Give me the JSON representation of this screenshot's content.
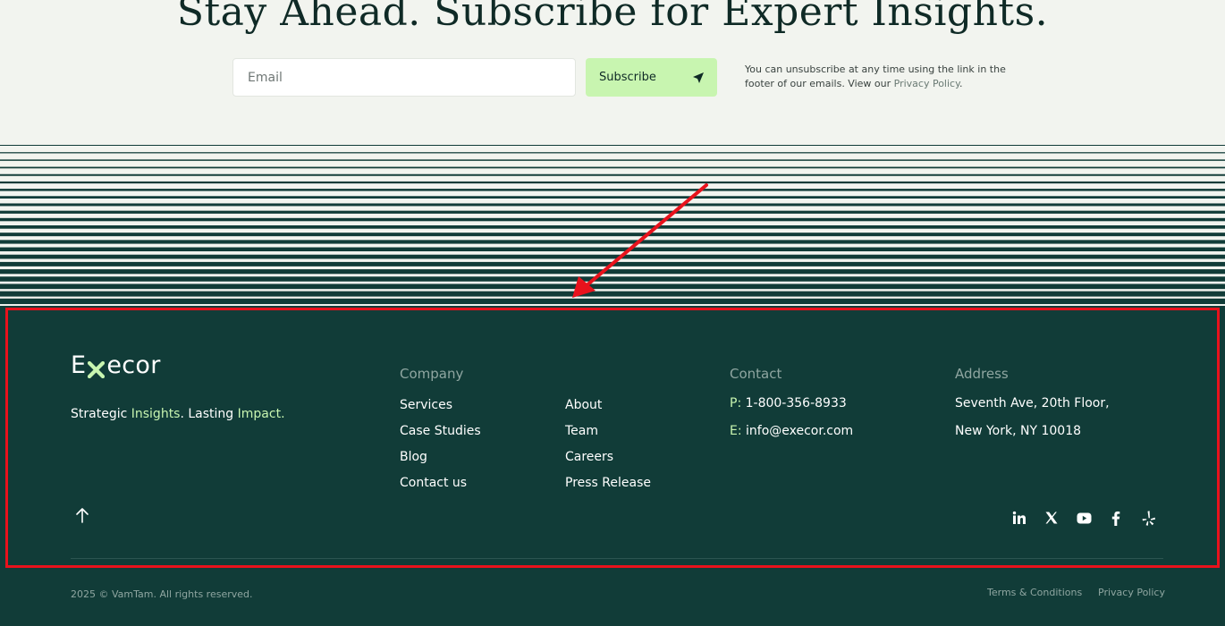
{
  "subscribe": {
    "title": "Stay Ahead. Subscribe for Expert Insights.",
    "email_placeholder": "Email",
    "button_label": "Subscribe",
    "note_text": "You can unsubscribe at any time using the link in the footer of our emails. View our ",
    "note_link": "Privacy Policy",
    "note_end": "."
  },
  "footer": {
    "logo_prefix": "E",
    "logo_suffix": "ecor",
    "tagline_1": "Strategic ",
    "tagline_accent_1": "Insights",
    "tagline_2": ". Lasting ",
    "tagline_accent_2": "Impact.",
    "company_heading": "Company",
    "company_links_left": [
      "Services",
      "Case Studies",
      "Blog",
      "Contact us"
    ],
    "company_links_right": [
      "About",
      "Team",
      "Careers",
      "Press Release"
    ],
    "contact_heading": "Contact",
    "phone_prefix": "P:",
    "phone": "1-800-356-8933",
    "email_prefix": "E:",
    "email": "info@execor.com",
    "address_heading": "Address",
    "address_line_1": "Seventh Ave, 20th Floor,",
    "address_line_2": "New York, NY 10018",
    "social_icons": [
      "linkedin-icon",
      "x-icon",
      "youtube-icon",
      "facebook-icon",
      "yelp-icon"
    ],
    "copyright": "2025 © VamTam. All rights reserved.",
    "terms": "Terms & Conditions",
    "privacy": "Privacy Policy"
  },
  "colors": {
    "footer_bg": "#113c38",
    "accent": "#c8f5b0",
    "highlight": "#e8121c",
    "page_bg": "#f2f4ef"
  }
}
